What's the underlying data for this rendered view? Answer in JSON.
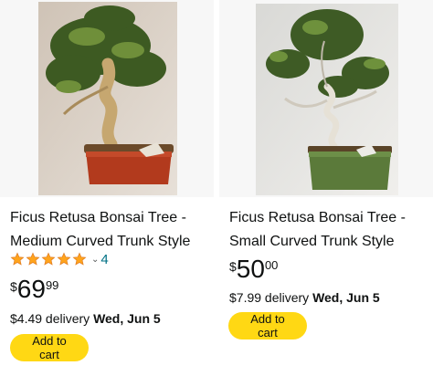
{
  "products": [
    {
      "image_alt": "Ficus Retusa Bonsai Tree in red pot",
      "title_line1": "Ficus Retusa Bonsai Tree -",
      "title_line2": "Medium Curved Trunk Style",
      "rating_stars": 5,
      "rating_count": "4",
      "price_symbol": "$",
      "price_whole": "69",
      "price_fraction": "99",
      "delivery_fee": "$4.49 delivery",
      "delivery_date": "Wed, Jun 5",
      "add_to_cart_label": "Add to cart"
    },
    {
      "image_alt": "Ficus Retusa Bonsai Tree in green pot",
      "title_line1": "Ficus Retusa Bonsai Tree -",
      "title_line2": "Small Curved Trunk Style",
      "price_symbol": "$",
      "price_whole": "50",
      "price_fraction": "00",
      "delivery_fee": "$7.99 delivery",
      "delivery_date": "Wed, Jun 5",
      "add_to_cart_label": "Add to cart"
    }
  ],
  "colors": {
    "button": "#ffd814",
    "star": "#ffa41c",
    "link": "#007185",
    "text": "#0f1111"
  },
  "icons": [
    "star-icon",
    "chevron-down-icon"
  ]
}
